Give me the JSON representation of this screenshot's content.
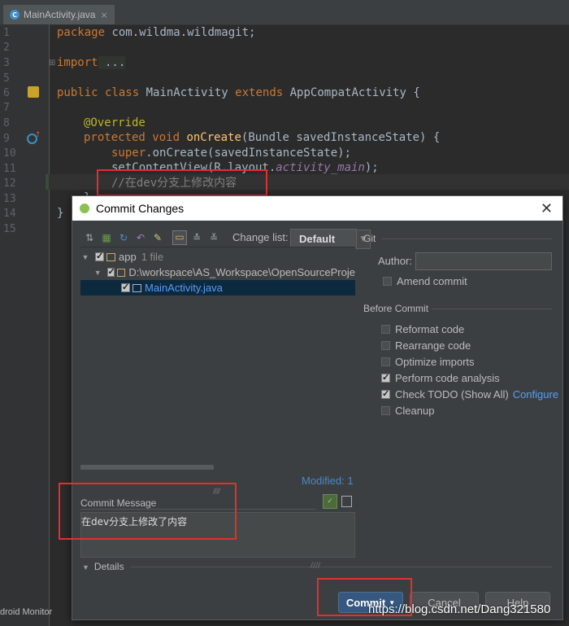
{
  "editor": {
    "tab_label": "MainActivity.java",
    "tab_close": "×",
    "line_numbers": [
      "1",
      "2",
      "3",
      "5",
      "6",
      "7",
      "8",
      "9",
      "10",
      "11",
      "12",
      "13",
      "14",
      "15"
    ],
    "lines": {
      "l1_kw": "package",
      "l1_rest": " com.wildma.wildmagit;",
      "l3_kw": "import",
      "l3_rest": " ...",
      "l6_a": "public class",
      "l6_b": " MainActivity ",
      "l6_c": "extends",
      "l6_d": " AppCompatActivity {",
      "l8": "@Override",
      "l9_a": "protected void",
      "l9_b": "onCreate",
      "l9_c": "(Bundle savedInstanceState) {",
      "l10_a": "super",
      "l10_b": ".onCreate(savedInstanceState);",
      "l11_a": "setContentView(R.layout.",
      "l11_b": "activity_main",
      "l11_c": ");",
      "l12": "//在dev分支上修改内容",
      "l13": "}",
      "l14": "}"
    }
  },
  "dialog": {
    "title": "Commit Changes",
    "close": "✕",
    "change_list_label": "Change list:",
    "change_list_value": "Default",
    "tree": {
      "root_label": "app",
      "root_count": "1 file",
      "dir_label": "D:\\workspace\\AS_Workspace\\OpenSourceProje",
      "file_label": "MainActivity.java"
    },
    "modified": "Modified: 1",
    "git_section": "Git",
    "author_label": "Author:",
    "author_value": "",
    "amend_commit": "Amend commit",
    "before_commit": "Before Commit",
    "options": [
      {
        "label": "Reformat code",
        "checked": false
      },
      {
        "label": "Rearrange code",
        "checked": false
      },
      {
        "label": "Optimize imports",
        "checked": false
      },
      {
        "label": "Perform code analysis",
        "checked": true
      },
      {
        "label": "Check TODO (Show All)",
        "checked": true
      },
      {
        "label": "Cleanup",
        "checked": false
      }
    ],
    "configure_link": "Configure",
    "commit_message_label": "Commit Message",
    "commit_message_value": "在dev分支上修改了内容",
    "details_label": "Details",
    "commit_button": "Commit",
    "cancel_button": "Cancel",
    "help_button": "Help"
  },
  "status": {
    "bottom_left": "droid Monitor",
    "watermark": "https://blog.csdn.net/Dang321580"
  },
  "colors": {
    "accent_red": "#e03030",
    "link_blue": "#589df6",
    "commit_button": "#365880"
  }
}
